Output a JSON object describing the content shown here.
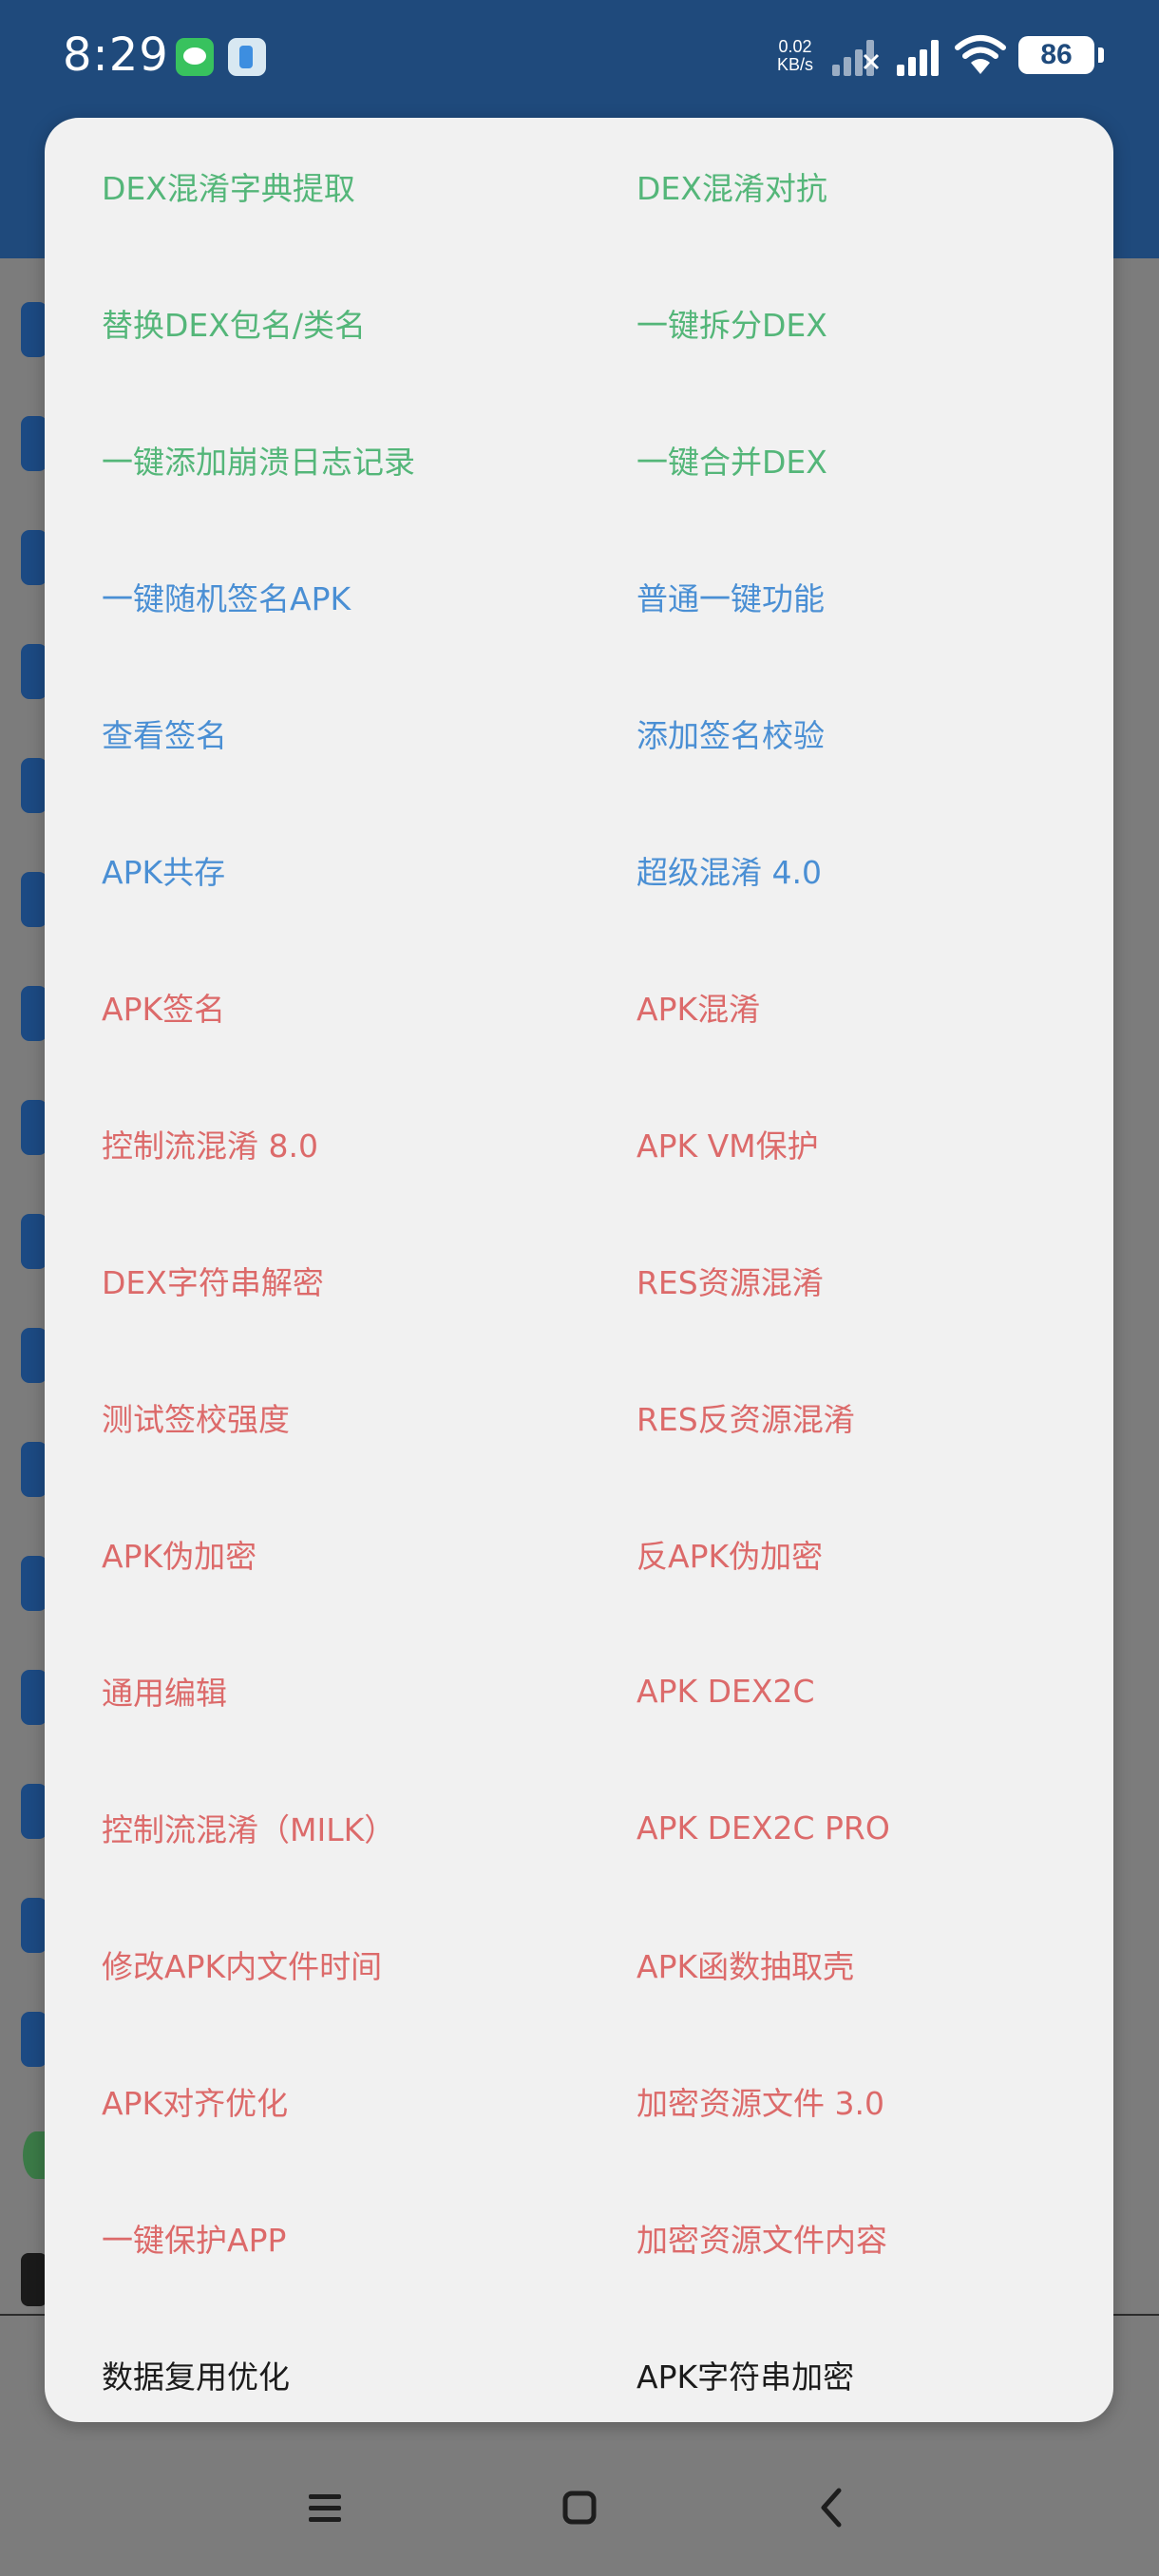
{
  "status_bar": {
    "time": "8:29",
    "net_speed_value": "0.02",
    "net_speed_unit": "KB/s",
    "battery": "86",
    "icons": [
      "wechat-icon",
      "notes-icon",
      "signal-icon",
      "signal-icon",
      "wifi-icon",
      "battery-icon"
    ]
  },
  "dialog": {
    "rows": [
      {
        "left": "DEX混淆字典提取",
        "right": "DEX混淆对抗",
        "color": "green"
      },
      {
        "left": "替换DEX包名/类名",
        "right": "一键拆分DEX",
        "color": "green"
      },
      {
        "left": "一键添加崩溃日志记录",
        "right": "一键合并DEX",
        "color": "green"
      },
      {
        "left": "一键随机签名APK",
        "right": "普通一键功能",
        "color": "blue"
      },
      {
        "left": "查看签名",
        "right": "添加签名校验",
        "color": "blue"
      },
      {
        "left": "APK共存",
        "right": "超级混淆 4.0",
        "color": "blue"
      },
      {
        "left": "APK签名",
        "right": "APK混淆",
        "color": "red"
      },
      {
        "left": "控制流混淆 8.0",
        "right": "APK VM保护",
        "color": "red"
      },
      {
        "left": "DEX字符串解密",
        "right": "RES资源混淆",
        "color": "red"
      },
      {
        "left": "测试签校强度",
        "right": "RES反资源混淆",
        "color": "red"
      },
      {
        "left": "APK伪加密",
        "right": "反APK伪加密",
        "color": "red"
      },
      {
        "left": "通用编辑",
        "right": "APK DEX2C",
        "color": "red"
      },
      {
        "left": "控制流混淆（MILK）",
        "right": "APK DEX2C PRO",
        "color": "red"
      },
      {
        "left": "修改APK内文件时间",
        "right": "APK函数抽取壳",
        "color": "red"
      },
      {
        "left": "APK对齐优化",
        "right": "加密资源文件 3.0",
        "color": "red"
      },
      {
        "left": "一键保护APP",
        "right": "加密资源文件内容",
        "color": "red"
      },
      {
        "left": "数据复用优化",
        "right": "APK字符串加密",
        "color": "black"
      }
    ]
  },
  "nav_bar": {
    "icons": [
      "menu-icon",
      "home-icon",
      "back-icon"
    ]
  }
}
